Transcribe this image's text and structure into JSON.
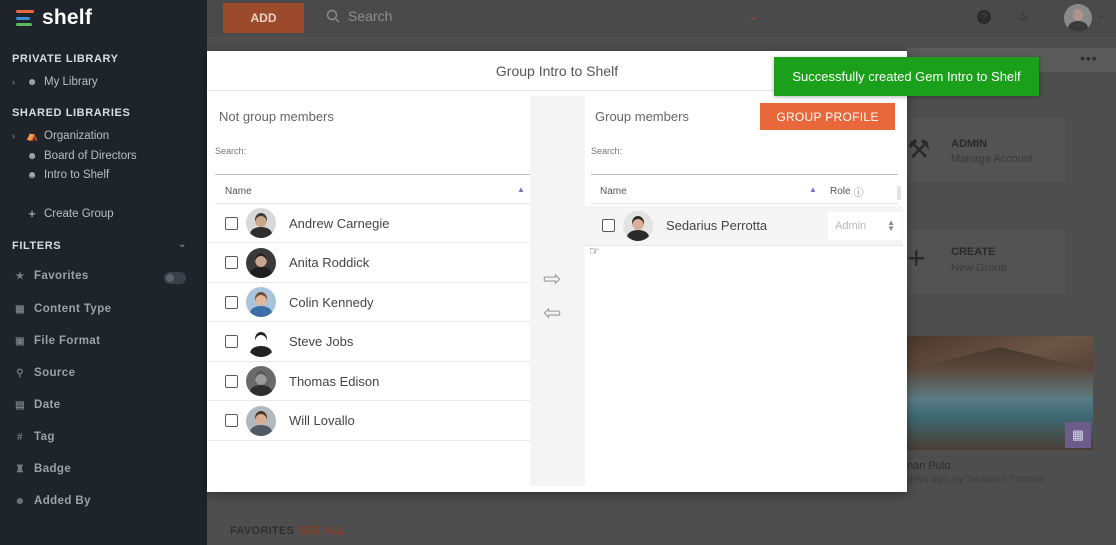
{
  "brand": {
    "name": "shelf",
    "logo_colors": [
      "#e8683b",
      "#3b8fd9",
      "#5cb85c"
    ]
  },
  "sidebar": {
    "private_title": "PRIVATE LIBRARY",
    "private_items": [
      {
        "label": "My Library",
        "icon": "user-icon"
      }
    ],
    "shared_title": "SHARED LIBRARIES",
    "shared_items": [
      {
        "label": "Organization",
        "icon": "building-icon"
      },
      {
        "label": "Board of Directors",
        "icon": "group-icon"
      },
      {
        "label": "Intro to Shelf",
        "icon": "group-icon"
      }
    ],
    "create_group": "Create Group",
    "filters_title": "FILTERS",
    "filters": [
      {
        "label": "Favorites",
        "icon": "star-icon"
      },
      {
        "label": "Content Type",
        "icon": "grid-icon"
      },
      {
        "label": "File Format",
        "icon": "file-icon"
      },
      {
        "label": "Source",
        "icon": "search-icon"
      },
      {
        "label": "Date",
        "icon": "calendar-icon"
      },
      {
        "label": "Tag",
        "icon": "hash-icon"
      },
      {
        "label": "Badge",
        "icon": "badge-icon"
      },
      {
        "label": "Added By",
        "icon": "user-icon"
      }
    ]
  },
  "topbar": {
    "add_label": "ADD",
    "search_placeholder": "Search"
  },
  "background": {
    "admin_title": "ADMIN",
    "admin_sub": "Manage Account",
    "create_title": "CREATE",
    "create_sub": "New Group",
    "photo_caption": "nan Pulo",
    "photo_meta": "days ago, by Sedarius Perrotta",
    "favorites_label": "FAVORITES",
    "see_all_label": "SEE ALL"
  },
  "modal": {
    "title": "Group Intro to Shelf",
    "left": {
      "heading": "Not group members",
      "search_label": "Search:",
      "col_name": "Name",
      "rows": [
        {
          "name": "Andrew Carnegie",
          "skin": "#c9a58a",
          "hair": "#3a3a3a",
          "bg": "#d8d8d8",
          "shirt": "#2d2d2d"
        },
        {
          "name": "Anita Roddick",
          "skin": "#c8a58f",
          "hair": "#2a2220",
          "bg": "#3a3a3a",
          "shirt": "#1e1e1e"
        },
        {
          "name": "Colin Kennedy",
          "skin": "#e0b79b",
          "hair": "#6a4a32",
          "bg": "#a8c4dc",
          "shirt": "#3c6fa8"
        },
        {
          "name": "Steve Jobs",
          "skin": "#ffffff",
          "hair": "#222222",
          "bg": "#ffffff",
          "shirt": "#222222"
        },
        {
          "name": "Thomas Edison",
          "skin": "#9a9a9a",
          "hair": "#555555",
          "bg": "#6a6a6a",
          "shirt": "#2e2e2e"
        },
        {
          "name": "Will Lovallo",
          "skin": "#d8ae92",
          "hair": "#4a3526",
          "bg": "#b0b8c0",
          "shirt": "#505a64"
        }
      ]
    },
    "right": {
      "heading": "Group members",
      "group_profile": "GROUP PROFILE",
      "search_label": "Search:",
      "col_name": "Name",
      "col_role": "Role",
      "members": [
        {
          "name": "Sedarius Perrotta",
          "role": "Admin",
          "skin": "#d9b096",
          "hair": "#2a2a2a",
          "bg": "#e3e3e3",
          "shirt": "#2a2a2a"
        }
      ]
    }
  },
  "toast": {
    "message": "Successfully created Gem Intro to Shelf",
    "color": "#1aa01a"
  }
}
